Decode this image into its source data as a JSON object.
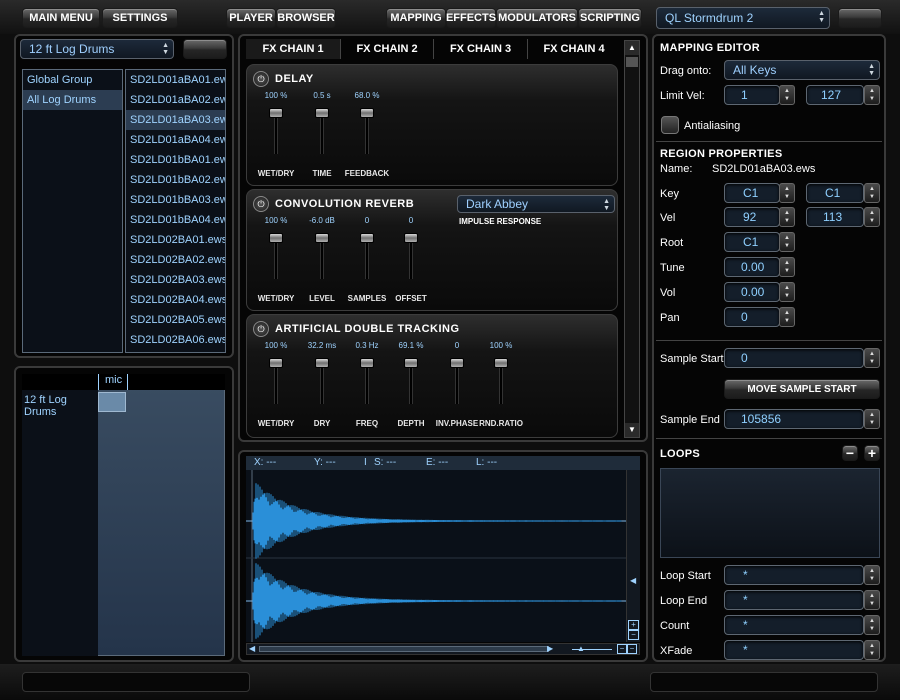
{
  "topbar": {
    "main_menu": "MAIN MENU",
    "settings": "SETTINGS",
    "player": "PLAYER",
    "browser": "BROWSER",
    "mapping": "MAPPING",
    "effects": "EFFECTS",
    "modulators": "MODULATORS",
    "scripting": "SCRIPTING",
    "instrument": "QL Stormdrum 2"
  },
  "left": {
    "instrument_select": "12 ft Log Drums",
    "groups": [
      "Global Group",
      "All Log Drums"
    ],
    "samples": [
      "SD2LD01aBA01.ews",
      "SD2LD01aBA02.ews",
      "SD2LD01aBA03.ews",
      "SD2LD01aBA04.ews",
      "SD2LD01bBA01.ews",
      "SD2LD01bBA02.ews",
      "SD2LD01bBA03.ews",
      "SD2LD01bBA04.ews",
      "SD2LD02BA01.ews",
      "SD2LD02BA02.ews",
      "SD2LD02BA03.ews",
      "SD2LD02BA04.ews",
      "SD2LD02BA05.ews",
      "SD2LD02BA06.ews"
    ],
    "mic_header": "mic",
    "mic_row_label": "12 ft Log Drums"
  },
  "fx": {
    "tabs": [
      "FX CHAIN 1",
      "FX CHAIN 2",
      "FX CHAIN 3",
      "FX CHAIN 4"
    ],
    "delay": {
      "title": "DELAY",
      "faders": [
        {
          "val": "100 %",
          "name": "WET/DRY",
          "level": 1.0
        },
        {
          "val": "0.5 s",
          "name": "TIME",
          "level": 1.0
        },
        {
          "val": "68.0 %",
          "name": "FEEDBACK",
          "level": 1.0
        }
      ]
    },
    "reverb": {
      "title": "CONVOLUTION REVERB",
      "impulse_value": "Dark Abbey",
      "impulse_label": "IMPULSE RESPONSE",
      "faders": [
        {
          "val": "100 %",
          "name": "WET/DRY",
          "level": 1.0
        },
        {
          "val": "-6.0 dB",
          "name": "LEVEL",
          "level": 1.0
        },
        {
          "val": "0",
          "name": "SAMPLES",
          "level": 1.0
        },
        {
          "val": "0",
          "name": "OFFSET",
          "level": 1.0
        }
      ]
    },
    "adt": {
      "title": "ARTIFICIAL DOUBLE TRACKING",
      "faders": [
        {
          "val": "100 %",
          "name": "WET/DRY",
          "level": 1.0
        },
        {
          "val": "32.2 ms",
          "name": "DRY",
          "level": 1.0
        },
        {
          "val": "0.3 Hz",
          "name": "FREQ",
          "level": 1.0
        },
        {
          "val": "69.1 %",
          "name": "DEPTH",
          "level": 1.0
        },
        {
          "val": "0",
          "name": "INV.PHASE",
          "level": 1.0
        },
        {
          "val": "100 %",
          "name": "RND.RATIO",
          "level": 1.0
        }
      ]
    }
  },
  "wave": {
    "x": "X: ---",
    "y": "Y: ---",
    "i": "I",
    "s": "S: ---",
    "e": "E: ---",
    "l": "L: ---"
  },
  "mapping": {
    "title": "MAPPING EDITOR",
    "drag_onto": "Drag onto:",
    "drag_value": "All Keys",
    "limit_vel": "Limit Vel:",
    "limit_low": "1",
    "limit_high": "127",
    "antialiasing": "Antialiasing"
  },
  "region": {
    "title": "REGION PROPERTIES",
    "name_label": "Name:",
    "name_value": "SD2LD01aBA03.ews",
    "key": "Key",
    "key_low": "C1",
    "key_high": "C1",
    "vel": "Vel",
    "vel_low": "92",
    "vel_high": "113",
    "root": "Root",
    "root_value": "C1",
    "tune": "Tune",
    "tune_value": "0.00",
    "vol": "Vol",
    "vol_value": "0.00",
    "pan": "Pan",
    "pan_value": "0",
    "sample_start": "Sample Start",
    "sample_start_value": "0",
    "move_sample_start": "MOVE SAMPLE START",
    "sample_end": "Sample End",
    "sample_end_value": "105856"
  },
  "loops": {
    "title": "LOOPS",
    "minus": "−",
    "plus": "+",
    "loop_start": "Loop Start",
    "loop_start_value": "*",
    "loop_end": "Loop End",
    "loop_end_value": "*",
    "count": "Count",
    "count_value": "*",
    "xfade": "XFade",
    "xfade_value": "*"
  }
}
